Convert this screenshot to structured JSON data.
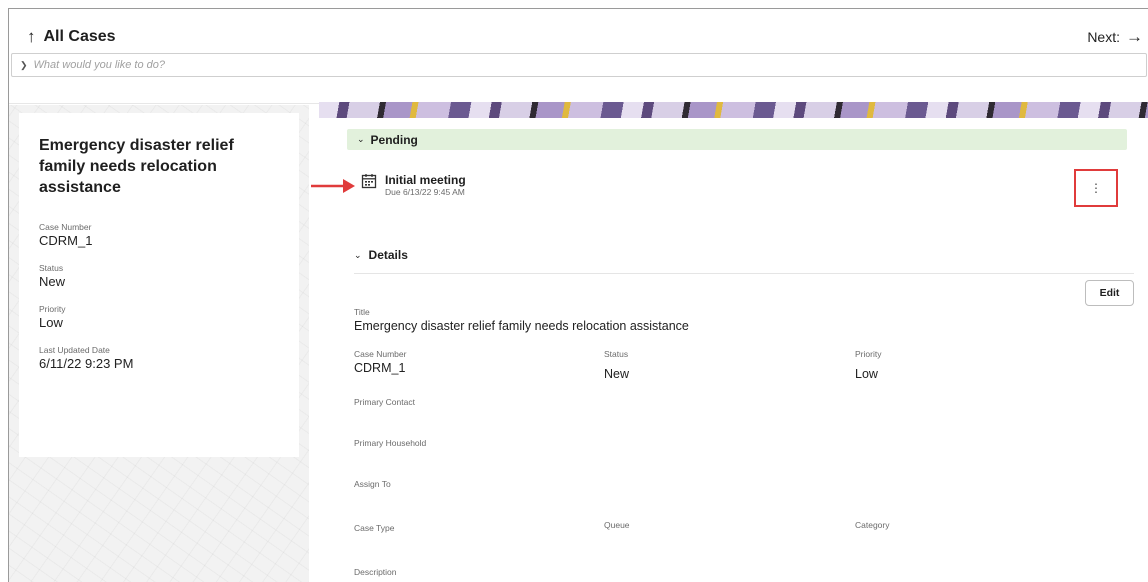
{
  "header": {
    "back_label": "All Cases",
    "next_label": "Next:"
  },
  "command": {
    "placeholder": "What would you like to do?"
  },
  "case": {
    "title": "Emergency disaster relief family needs relocation assistance",
    "fields": [
      {
        "label": "Case Number",
        "value": "CDRM_1"
      },
      {
        "label": "Status",
        "value": "New"
      },
      {
        "label": "Priority",
        "value": "Low"
      },
      {
        "label": "Last Updated Date",
        "value": "6/11/22 9:23 PM"
      }
    ]
  },
  "pending": {
    "label": "Pending",
    "task": {
      "title": "Initial meeting",
      "due": "Due 6/13/22 9:45 AM"
    }
  },
  "details": {
    "header": "Details",
    "edit_label": "Edit",
    "title_label": "Title",
    "title_value": "Emergency disaster relief family needs relocation assistance",
    "case_number_label": "Case Number",
    "case_number_value": "CDRM_1",
    "status_label": "Status",
    "status_value": "New",
    "priority_label": "Priority",
    "priority_value": "Low",
    "primary_contact_label": "Primary Contact",
    "primary_household_label": "Primary Household",
    "assign_to_label": "Assign To",
    "case_type_label": "Case Type",
    "queue_label": "Queue",
    "category_label": "Category",
    "description_label": "Description"
  },
  "colors": {
    "pending_bar": "#e2f1dc",
    "highlight": "#e03b3b"
  },
  "icons": [
    "up-arrow-icon",
    "right-arrow-icon",
    "chevron-right-icon",
    "chevron-down-icon",
    "calendar-icon",
    "kebab-menu-icon",
    "annotation-arrow-icon"
  ]
}
